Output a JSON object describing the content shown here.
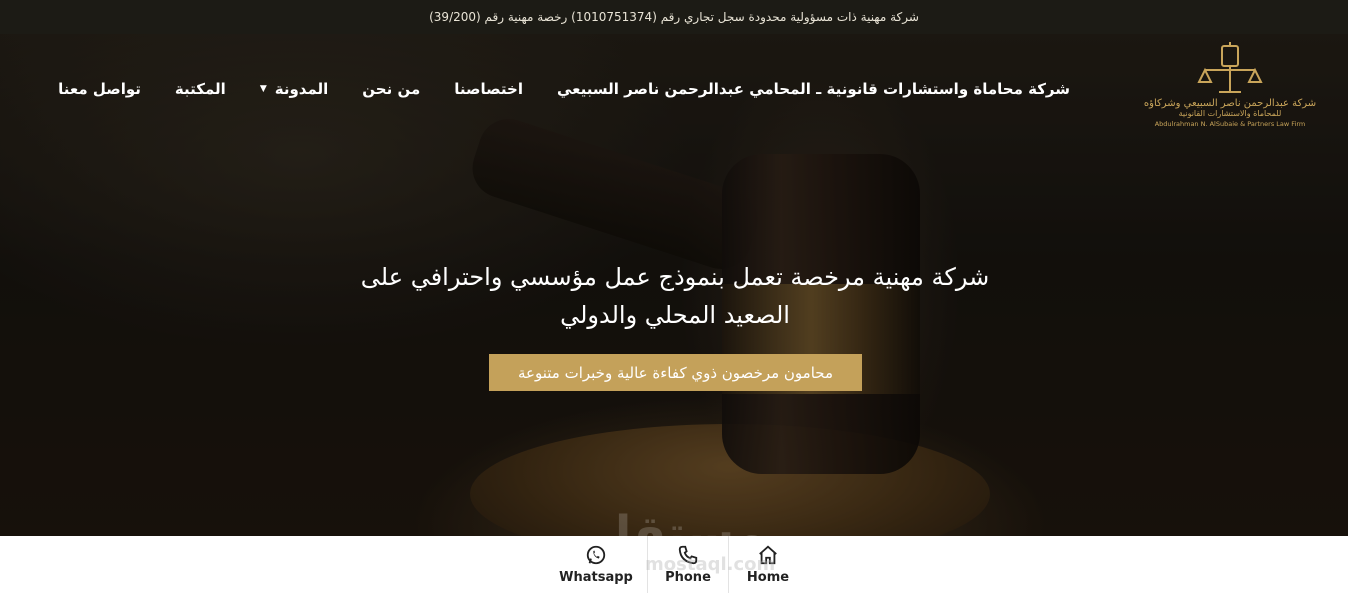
{
  "topbar": {
    "text": "شركة مهنية ذات مسؤولية محدودة سجل تجاري رقم (1010751374) رخصة مهنية رقم (39/200)"
  },
  "logo": {
    "name_ar": "شركة عبدالرحمن ناصر السبيعي وشركاؤه",
    "subtitle_ar": "للمحاماة والاستشارات القانونية",
    "name_en": "Abdulrahman N. AlSubaie & Partners Law Firm"
  },
  "nav": {
    "items": [
      {
        "label": "شركة محاماة واستشارات قانونية ـ المحامي عبدالرحمن ناصر السبيعي"
      },
      {
        "label": "اختصاصنا"
      },
      {
        "label": "من نحن"
      },
      {
        "label": "المدونة",
        "has_dropdown": true
      },
      {
        "label": "المكتبة"
      },
      {
        "label": "تواصل معنا"
      }
    ]
  },
  "hero": {
    "headline_line1": "شركة مهنية مرخصة تعمل بنموذج عمل مؤسسي واحترافي على",
    "headline_line2": "الصعيد المحلي والدولي",
    "cta_label": "محامون مرخصون ذوي كفاءة عالية وخبرات متنوعة"
  },
  "bottombar": {
    "items": [
      {
        "label": "Whatsapp",
        "icon": "whatsapp-icon"
      },
      {
        "label": "Phone",
        "icon": "phone-icon"
      },
      {
        "label": "Home",
        "icon": "home-icon"
      }
    ]
  },
  "watermark": {
    "ar": "مستقل",
    "en": "mostaql.com"
  },
  "colors": {
    "accent_gold": "#c4a15a",
    "topbar_bg": "#1c1b15",
    "bottombar_bg": "#ffffff"
  }
}
